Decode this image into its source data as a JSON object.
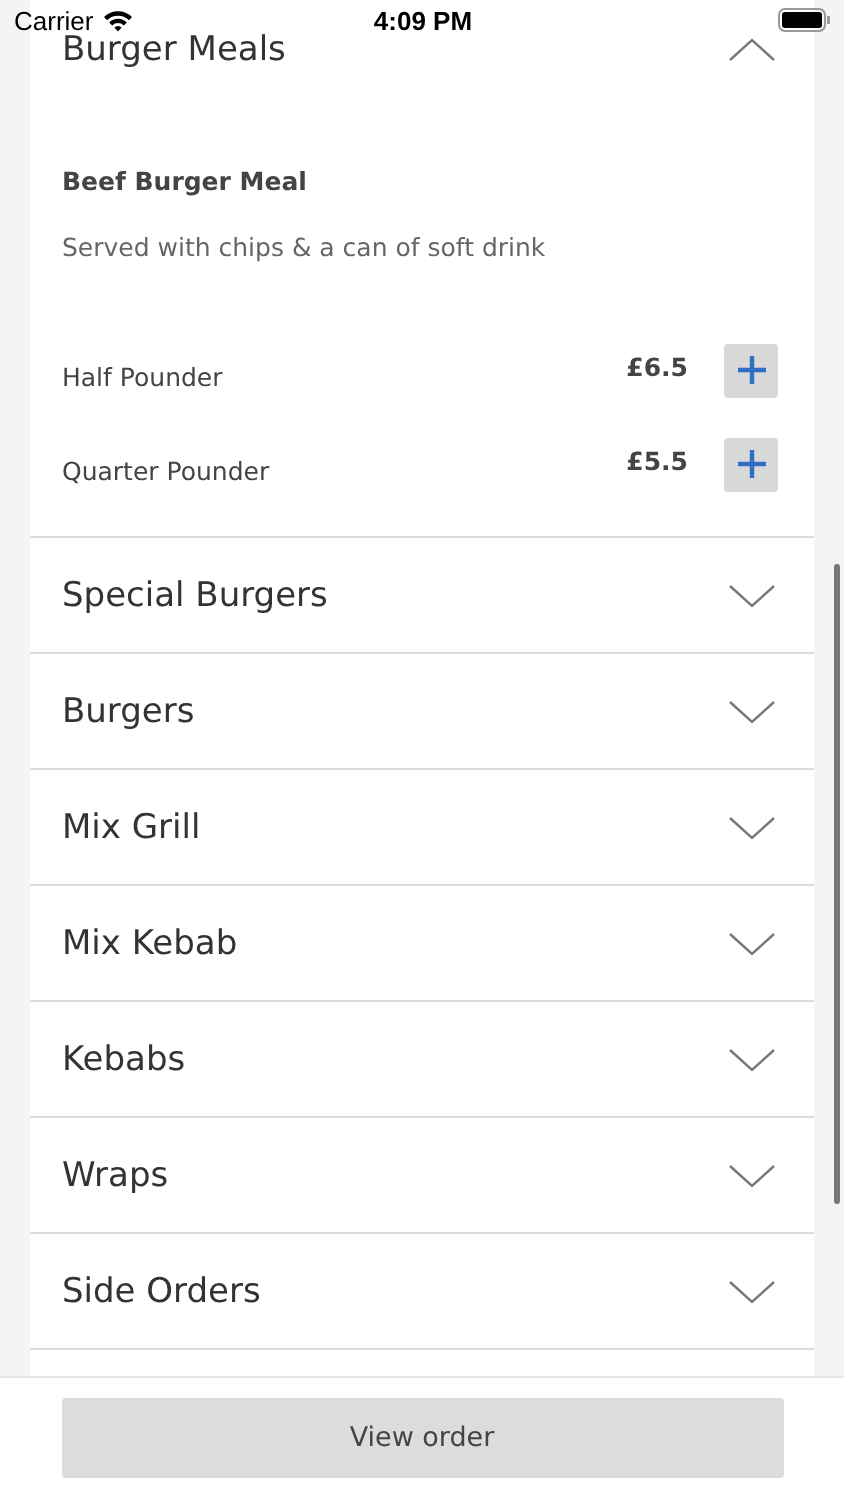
{
  "status_bar": {
    "carrier": "Carrier",
    "time": "4:09 PM"
  },
  "categories": [
    {
      "title": "Burger Meals",
      "expanded": true,
      "items": [
        {
          "name": "Beef Burger Meal",
          "description": "Served with chips & a can of soft drink",
          "options": [
            {
              "name": "Half Pounder",
              "price": "£6.5"
            },
            {
              "name": "Quarter Pounder",
              "price": "£5.5"
            }
          ]
        }
      ]
    },
    {
      "title": "Special Burgers",
      "expanded": false
    },
    {
      "title": "Burgers",
      "expanded": false
    },
    {
      "title": "Mix Grill",
      "expanded": false
    },
    {
      "title": "Mix Kebab",
      "expanded": false
    },
    {
      "title": "Kebabs",
      "expanded": false
    },
    {
      "title": "Wraps",
      "expanded": false
    },
    {
      "title": "Side Orders",
      "expanded": false
    }
  ],
  "view_order_button": "View order"
}
